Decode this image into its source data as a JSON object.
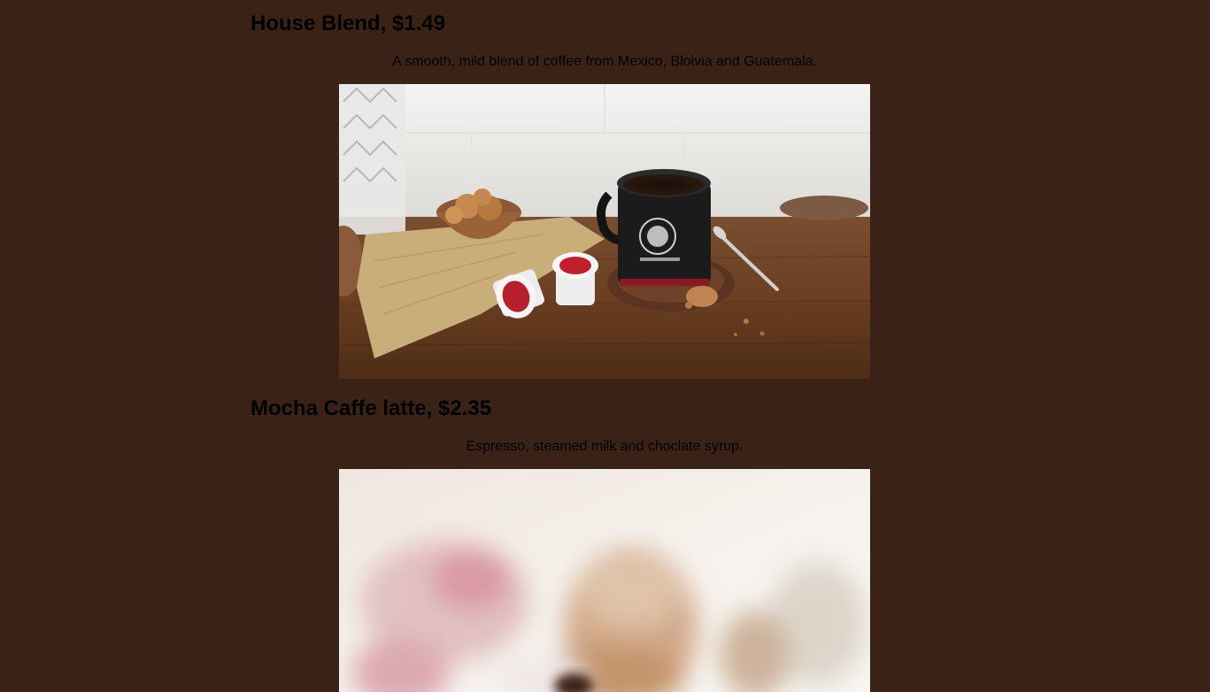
{
  "menu": {
    "items": [
      {
        "title": "House Blend, $1.49",
        "description": "A smooth, mild blend of coffee from Mexico, Bloivia and Guatemala."
      },
      {
        "title": "Mocha Caffe latte, $2.35",
        "description": "Espresso, steamed milk and choclate syrup."
      }
    ]
  },
  "colors": {
    "page_background": "#3b2216",
    "text": "#000000"
  }
}
